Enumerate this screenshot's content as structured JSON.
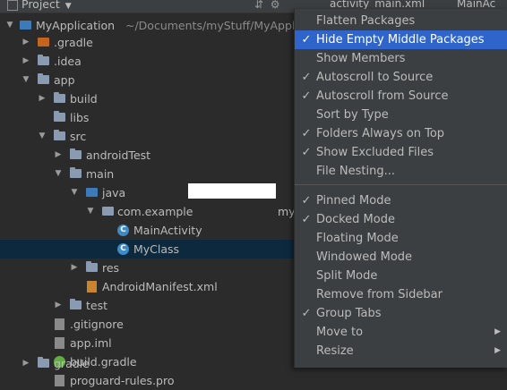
{
  "header": {
    "project_label": "Project",
    "tab1": "activity_main.xml",
    "tab2": "MainAc"
  },
  "tree": {
    "root_name": "MyApplication",
    "root_path": "~/Documents/myStuff/MyApplic",
    "gradle": ".gradle",
    "idea": ".idea",
    "app": "app",
    "build": "build",
    "libs": "libs",
    "src": "src",
    "android_test": "androidTest",
    "main": "main",
    "java": "java",
    "package": "com.example",
    "package_suffix": "my",
    "main_activity": "MainActivity",
    "my_class": "MyClass",
    "res": "res",
    "manifest": "AndroidManifest.xml",
    "test": "test",
    "gitignore": ".gitignore",
    "app_iml": "app.iml",
    "build_gradle": "build.gradle",
    "proguard": "proguard-rules.pro",
    "gradle_bottom": "gradle"
  },
  "menu": {
    "flatten_packages": "Flatten Packages",
    "hide_empty": "Hide Empty Middle Packages",
    "show_members": "Show Members",
    "autoscroll_to": "Autoscroll to Source",
    "autoscroll_from": "Autoscroll from Source",
    "sort_by_type": "Sort by Type",
    "folders_on_top": "Folders Always on Top",
    "show_excluded": "Show Excluded Files",
    "file_nesting": "File Nesting...",
    "pinned_mode": "Pinned Mode",
    "docked_mode": "Docked Mode",
    "floating_mode": "Floating Mode",
    "windowed_mode": "Windowed Mode",
    "split_mode": "Split Mode",
    "remove_sidebar": "Remove from Sidebar",
    "group_tabs": "Group Tabs",
    "move_to": "Move to",
    "resize": "Resize",
    "checkmark": "✓",
    "submenu_arrow": "▶"
  },
  "colors": {
    "menu_highlight": "#2f65ca",
    "selected_row": "#0d293e"
  }
}
